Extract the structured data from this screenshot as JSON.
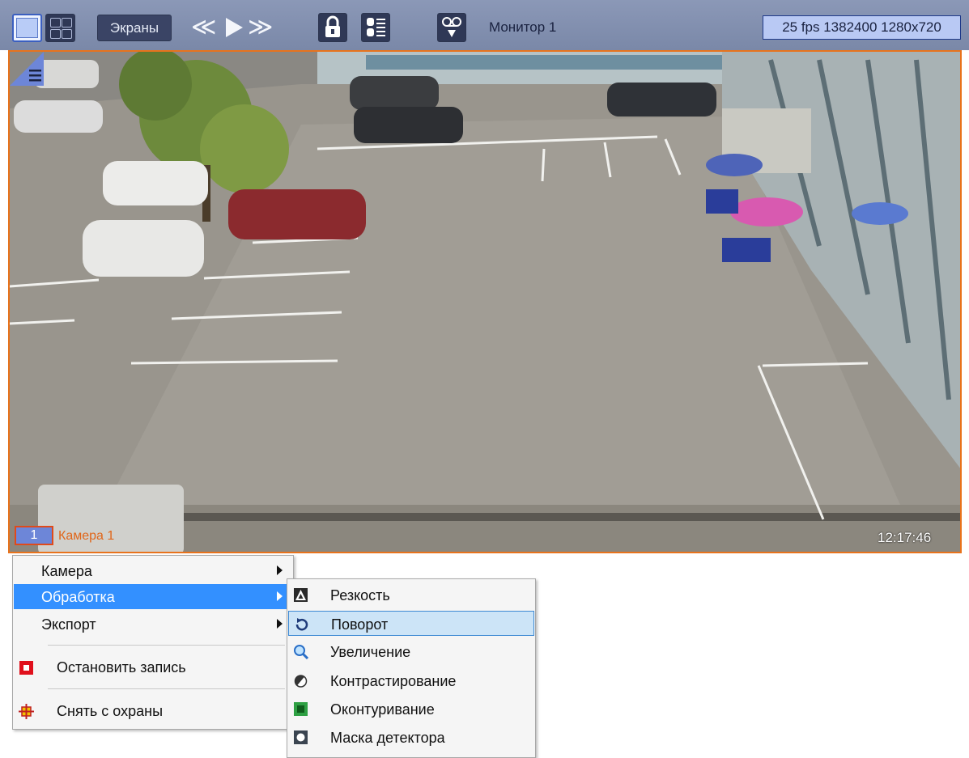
{
  "toolbar": {
    "screens_label": "Экраны",
    "monitor_label": "Монитор 1",
    "stream_info": "25 fps 1382400 1280x720",
    "icons": [
      "single-layout-icon",
      "quad-layout-icon",
      "rewind-icon",
      "play-icon",
      "forward-icon",
      "lock-icon",
      "list-icon",
      "record-archive-icon"
    ]
  },
  "video": {
    "camera_number": "1",
    "camera_name": "Камера 1",
    "timestamp": "12:17:46"
  },
  "context_menu": {
    "items": [
      {
        "label": "Камера",
        "submenu": true
      },
      {
        "label": "Обработка",
        "submenu": true,
        "selected": true
      },
      {
        "label": "Экспорт",
        "submenu": true
      },
      {
        "label": "Остановить запись",
        "icon": "stop-record-icon"
      },
      {
        "label": "Снять с охраны",
        "icon": "disarm-icon"
      }
    ]
  },
  "submenu": {
    "items": [
      {
        "label": "Резкость",
        "icon": "sharpness-icon"
      },
      {
        "label": "Поворот",
        "icon": "rotate-icon",
        "hovered": true
      },
      {
        "label": "Увеличение",
        "icon": "zoom-icon"
      },
      {
        "label": "Контрастирование",
        "icon": "contrast-icon"
      },
      {
        "label": "Оконтуривание",
        "icon": "contour-icon"
      },
      {
        "label": "Маска детектора",
        "icon": "detector-mask-icon"
      }
    ]
  },
  "colors": {
    "toolbar_bg": "#8b98b7",
    "accent_orange": "#e8731c",
    "menu_selected": "#3390ff",
    "menu_hover": "#cce4f7"
  }
}
